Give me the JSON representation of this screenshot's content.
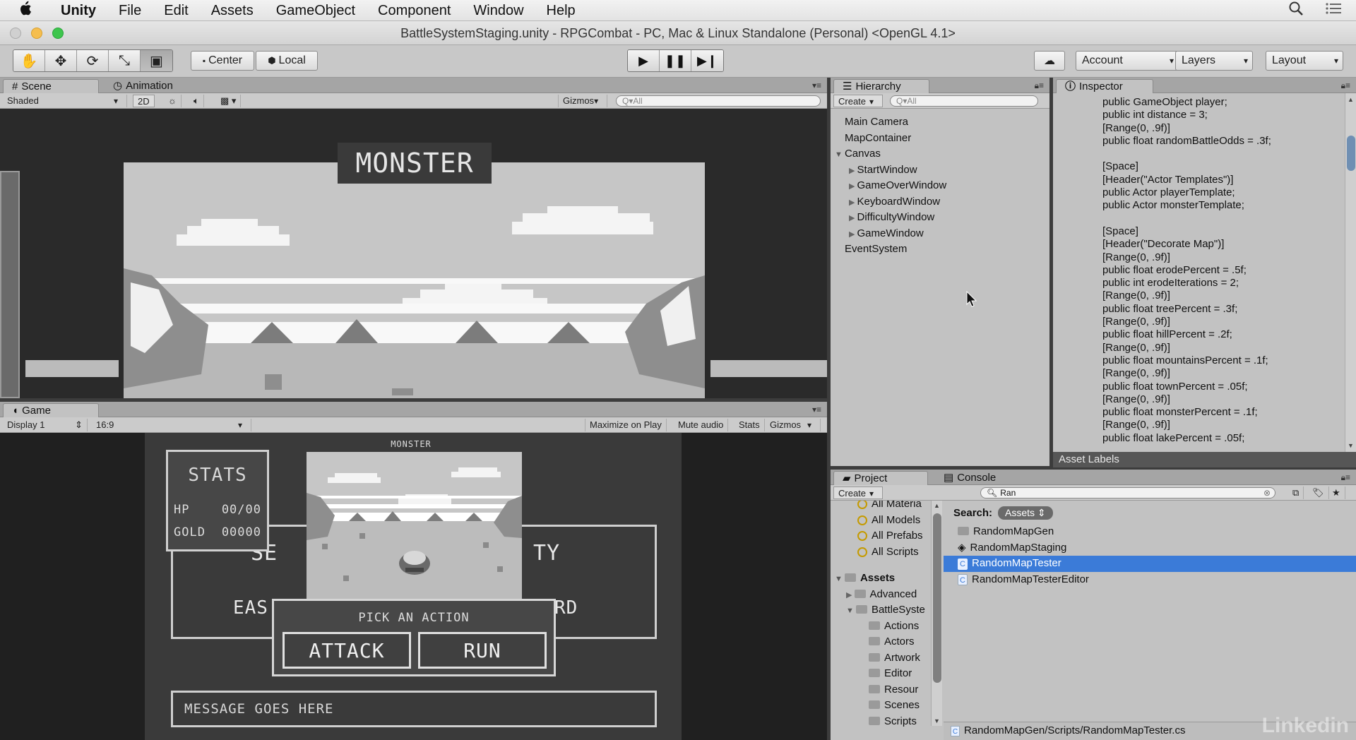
{
  "menubar": {
    "apple": "",
    "app": "Unity",
    "items": [
      "File",
      "Edit",
      "Assets",
      "GameObject",
      "Component",
      "Window",
      "Help"
    ]
  },
  "title": "BattleSystemStaging.unity - RPGCombat - PC, Mac & Linux Standalone (Personal) <OpenGL 4.1>",
  "toolbar": {
    "center": "Center",
    "local": "Local",
    "account": "Account",
    "layers": "Layers",
    "layout": "Layout"
  },
  "scene": {
    "tab_scene": "Scene",
    "tab_animation": "Animation",
    "shading": "Shaded",
    "mode_2d": "2D",
    "gizmos": "Gizmos",
    "search_placeholder": "Q▾All",
    "monster_label": "MONSTER"
  },
  "game": {
    "tab": "Game",
    "display": "Display 1",
    "aspect": "16:9",
    "maximize": "Maximize on Play",
    "mute": "Mute audio",
    "stats_btn": "Stats",
    "gizmos": "Gizmos",
    "stats_title": "STATS",
    "hp_label": "HP",
    "hp_value": "00/00",
    "gold_label": "GOLD",
    "gold_value": "00000",
    "monster_label": "MONSTER",
    "select_left": "SE",
    "select_right": "TY",
    "easy_partial": "EAS",
    "hard_partial": "RD",
    "pick_action": "PICK AN ACTION",
    "attack": "ATTACK",
    "run": "RUN",
    "message": "MESSAGE GOES HERE"
  },
  "hierarchy": {
    "tab": "Hierarchy",
    "create": "Create",
    "search_placeholder": "Q▾All",
    "items": {
      "main_camera": "Main Camera",
      "map_container": "MapContainer",
      "canvas": "Canvas",
      "start_window": "StartWindow",
      "gameover_window": "GameOverWindow",
      "keyboard_window": "KeyboardWindow",
      "difficulty_window": "DifficultyWindow",
      "game_window": "GameWindow",
      "event_system": "EventSystem"
    }
  },
  "inspector": {
    "tab": "Inspector",
    "code": "public GameObject player;\npublic int distance = 3;\n[Range(0, .9f)]\npublic float randomBattleOdds = .3f;\n\n[Space]\n[Header(\"Actor Templates\")]\npublic Actor playerTemplate;\npublic Actor monsterTemplate;\n\n[Space]\n[Header(\"Decorate Map\")]\n[Range(0, .9f)]\npublic float erodePercent = .5f;\npublic int erodeIterations = 2;\n[Range(0, .9f)]\npublic float treePercent = .3f;\n[Range(0, .9f)]\npublic float hillPercent = .2f;\n[Range(0, .9f)]\npublic float mountainsPercent = .1f;\n[Range(0, .9f)]\npublic float townPercent = .05f;\n[Range(0, .9f)]\npublic float monsterPercent = .1f;\n[Range(0, .9f)]\npublic float lakePercent = .05f;",
    "asset_labels": "Asset Labels"
  },
  "project": {
    "tab_project": "Project",
    "tab_console": "Console",
    "create": "Create",
    "search_value": "Ran",
    "search_label": "Search:",
    "search_scope": "Assets",
    "favorites": [
      "All Materia",
      "All Models",
      "All Prefabs",
      "All Scripts"
    ],
    "assets_root": "Assets",
    "folders": [
      "Advanced",
      "BattleSyste",
      "Actions",
      "Actors",
      "Artwork",
      "Editor",
      "Resour",
      "Scenes",
      "Scripts"
    ],
    "results": [
      "RandomMapGen",
      "RandomMapStaging",
      "RandomMapTester",
      "RandomMapTesterEditor"
    ],
    "path": "RandomMapGen/Scripts/RandomMapTester.cs"
  },
  "watermark": "Linkedin"
}
